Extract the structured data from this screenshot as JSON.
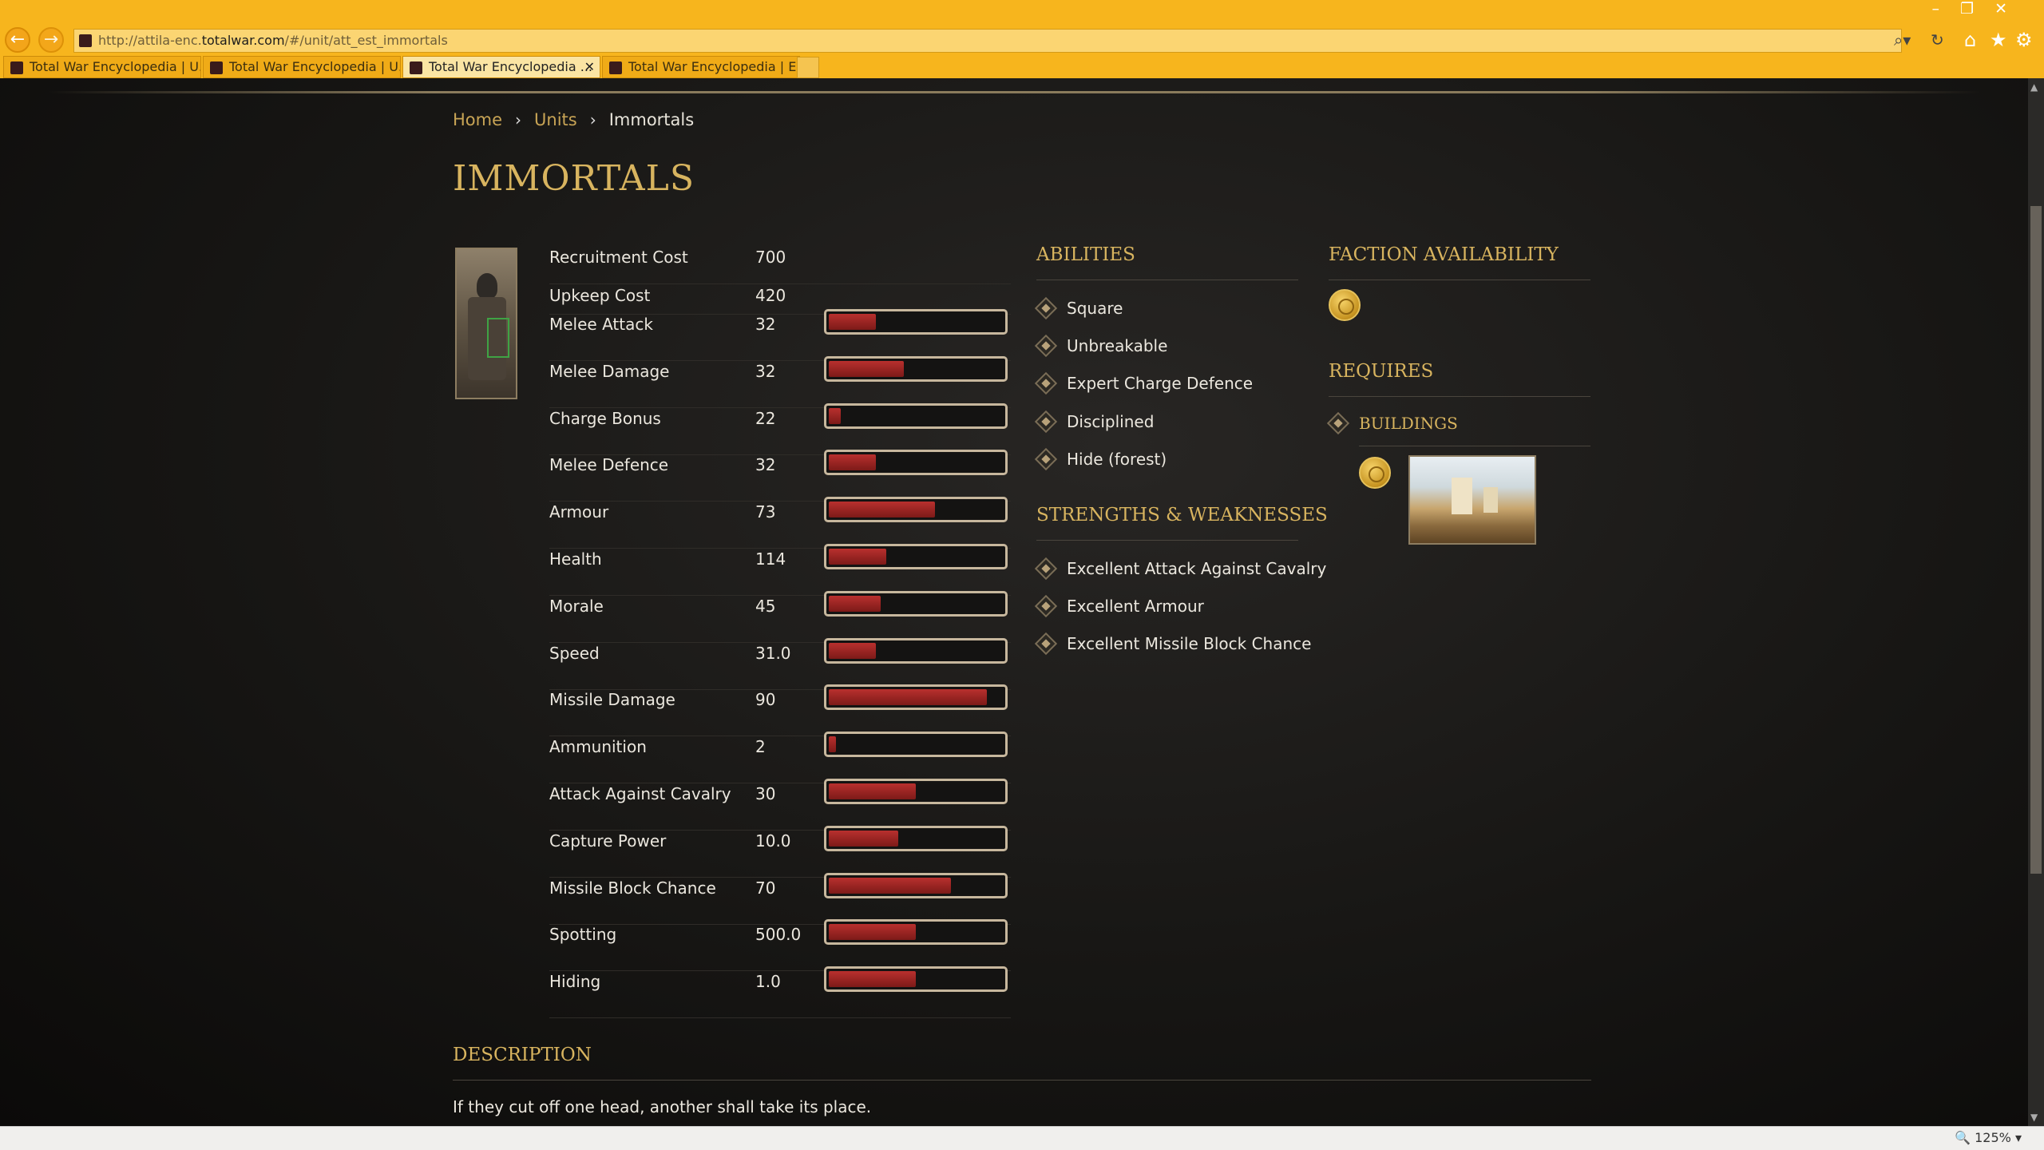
{
  "browser": {
    "url_prefix": "http://attila-enc.",
    "url_host": "totalwar.com",
    "url_path": "/#/unit/att_est_immortals",
    "tabs": [
      {
        "label": "Total War Encyclopedia | U..."
      },
      {
        "label": "Total War Encyclopedia | U..."
      },
      {
        "label": "Total War Encyclopedia ..."
      },
      {
        "label": "Total War Encyclopedia | E..."
      }
    ],
    "zoom": "125%"
  },
  "breadcrumb": {
    "home": "Home",
    "units": "Units",
    "current": "Immortals"
  },
  "unit": {
    "title": "IMMORTALS"
  },
  "stats": {
    "recruitment": {
      "label": "Recruitment Cost",
      "value": "700"
    },
    "upkeep": {
      "label": "Upkeep Cost",
      "value": "420"
    },
    "rows": [
      {
        "label": "Melee Attack",
        "value": "32",
        "fill": 0.27
      },
      {
        "label": "Melee Damage",
        "value": "32",
        "fill": 0.43
      },
      {
        "label": "Charge Bonus",
        "value": "22",
        "fill": 0.07
      },
      {
        "label": "Melee Defence",
        "value": "32",
        "fill": 0.27
      },
      {
        "label": "Armour",
        "value": "73",
        "fill": 0.61
      },
      {
        "label": "Health",
        "value": "114",
        "fill": 0.33
      },
      {
        "label": "Morale",
        "value": "45",
        "fill": 0.3
      },
      {
        "label": "Speed",
        "value": "31.0",
        "fill": 0.27
      },
      {
        "label": "Missile Damage",
        "value": "90",
        "fill": 0.91
      },
      {
        "label": "Ammunition",
        "value": "2",
        "fill": 0.04
      },
      {
        "label": "Attack Against Cavalry",
        "value": "30",
        "fill": 0.5
      },
      {
        "label": "Capture Power",
        "value": "10.0",
        "fill": 0.4
      },
      {
        "label": "Missile Block Chance",
        "value": "70",
        "fill": 0.7
      },
      {
        "label": "Spotting",
        "value": "500.0",
        "fill": 0.5
      },
      {
        "label": "Hiding",
        "value": "1.0",
        "fill": 0.5
      }
    ]
  },
  "abilities": {
    "heading": "ABILITIES",
    "items": [
      "Square",
      "Unbreakable",
      "Expert Charge Defence",
      "Disciplined",
      "Hide (forest)"
    ]
  },
  "strengths": {
    "heading": "STRENGTHS & WEAKNESSES",
    "items": [
      "Excellent Attack Against Cavalry",
      "Excellent Armour",
      "Excellent Missile Block Chance"
    ]
  },
  "faction": {
    "heading": "FACTION AVAILABILITY"
  },
  "requires": {
    "heading": "REQUIRES",
    "buildings": "BUILDINGS"
  },
  "description": {
    "heading": "DESCRIPTION",
    "text": "If they cut off one head, another shall take its place."
  },
  "colors": {
    "accent": "#d8b45f",
    "bar": "#b8302e",
    "chrome": "#f7b51d"
  }
}
